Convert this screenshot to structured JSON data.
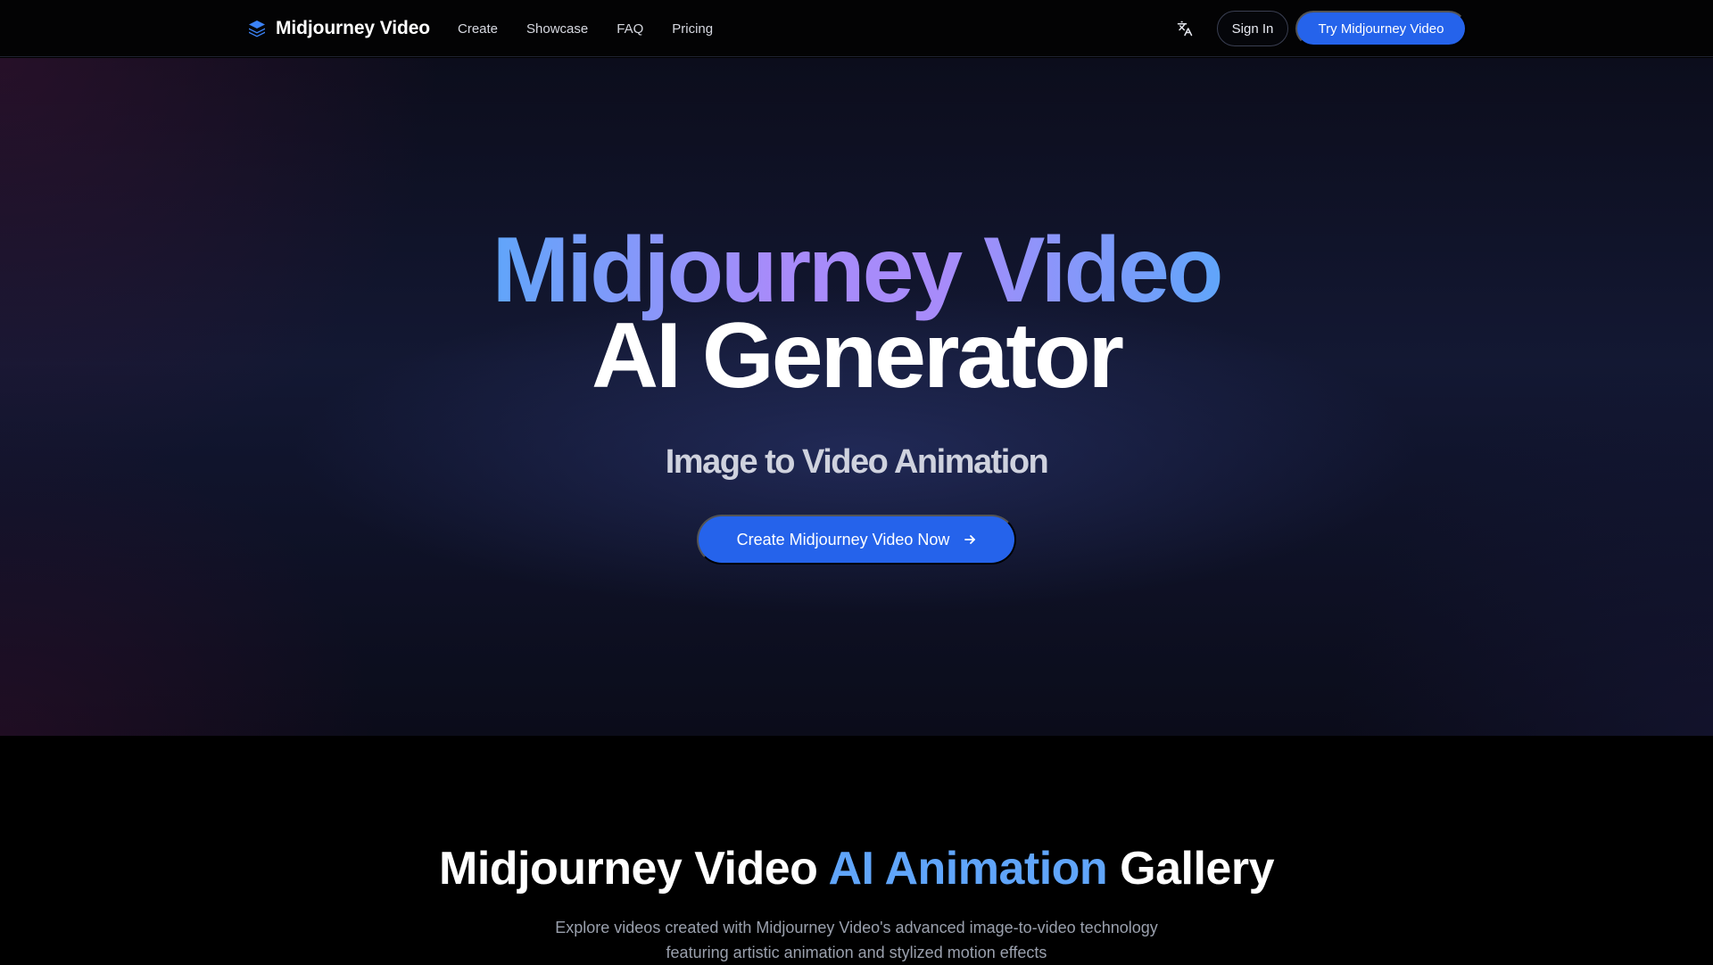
{
  "nav": {
    "brand": "Midjourney Video",
    "links": [
      "Create",
      "Showcase",
      "FAQ",
      "Pricing"
    ],
    "language_icon": "translate-icon",
    "sign_in": "Sign In",
    "try_button": "Try Midjourney Video"
  },
  "hero": {
    "title_line1": "Midjourney Video",
    "title_line2": "AI Generator",
    "subtitle": "Image to Video Animation",
    "cta": "Create Midjourney Video Now",
    "cta_icon": "arrow-right-icon"
  },
  "gallery": {
    "title_part1": "Midjourney Video",
    "title_accent": "AI Animation",
    "title_part2": "Gallery",
    "description": "Explore videos created with Midjourney Video's advanced image-to-video technology featuring artistic animation and stylized motion effects"
  },
  "colors": {
    "accent_blue": "#2563eb",
    "gradient_blue": "#60a5fa",
    "gradient_purple": "#a78bfa",
    "page_bg": "#000000"
  }
}
